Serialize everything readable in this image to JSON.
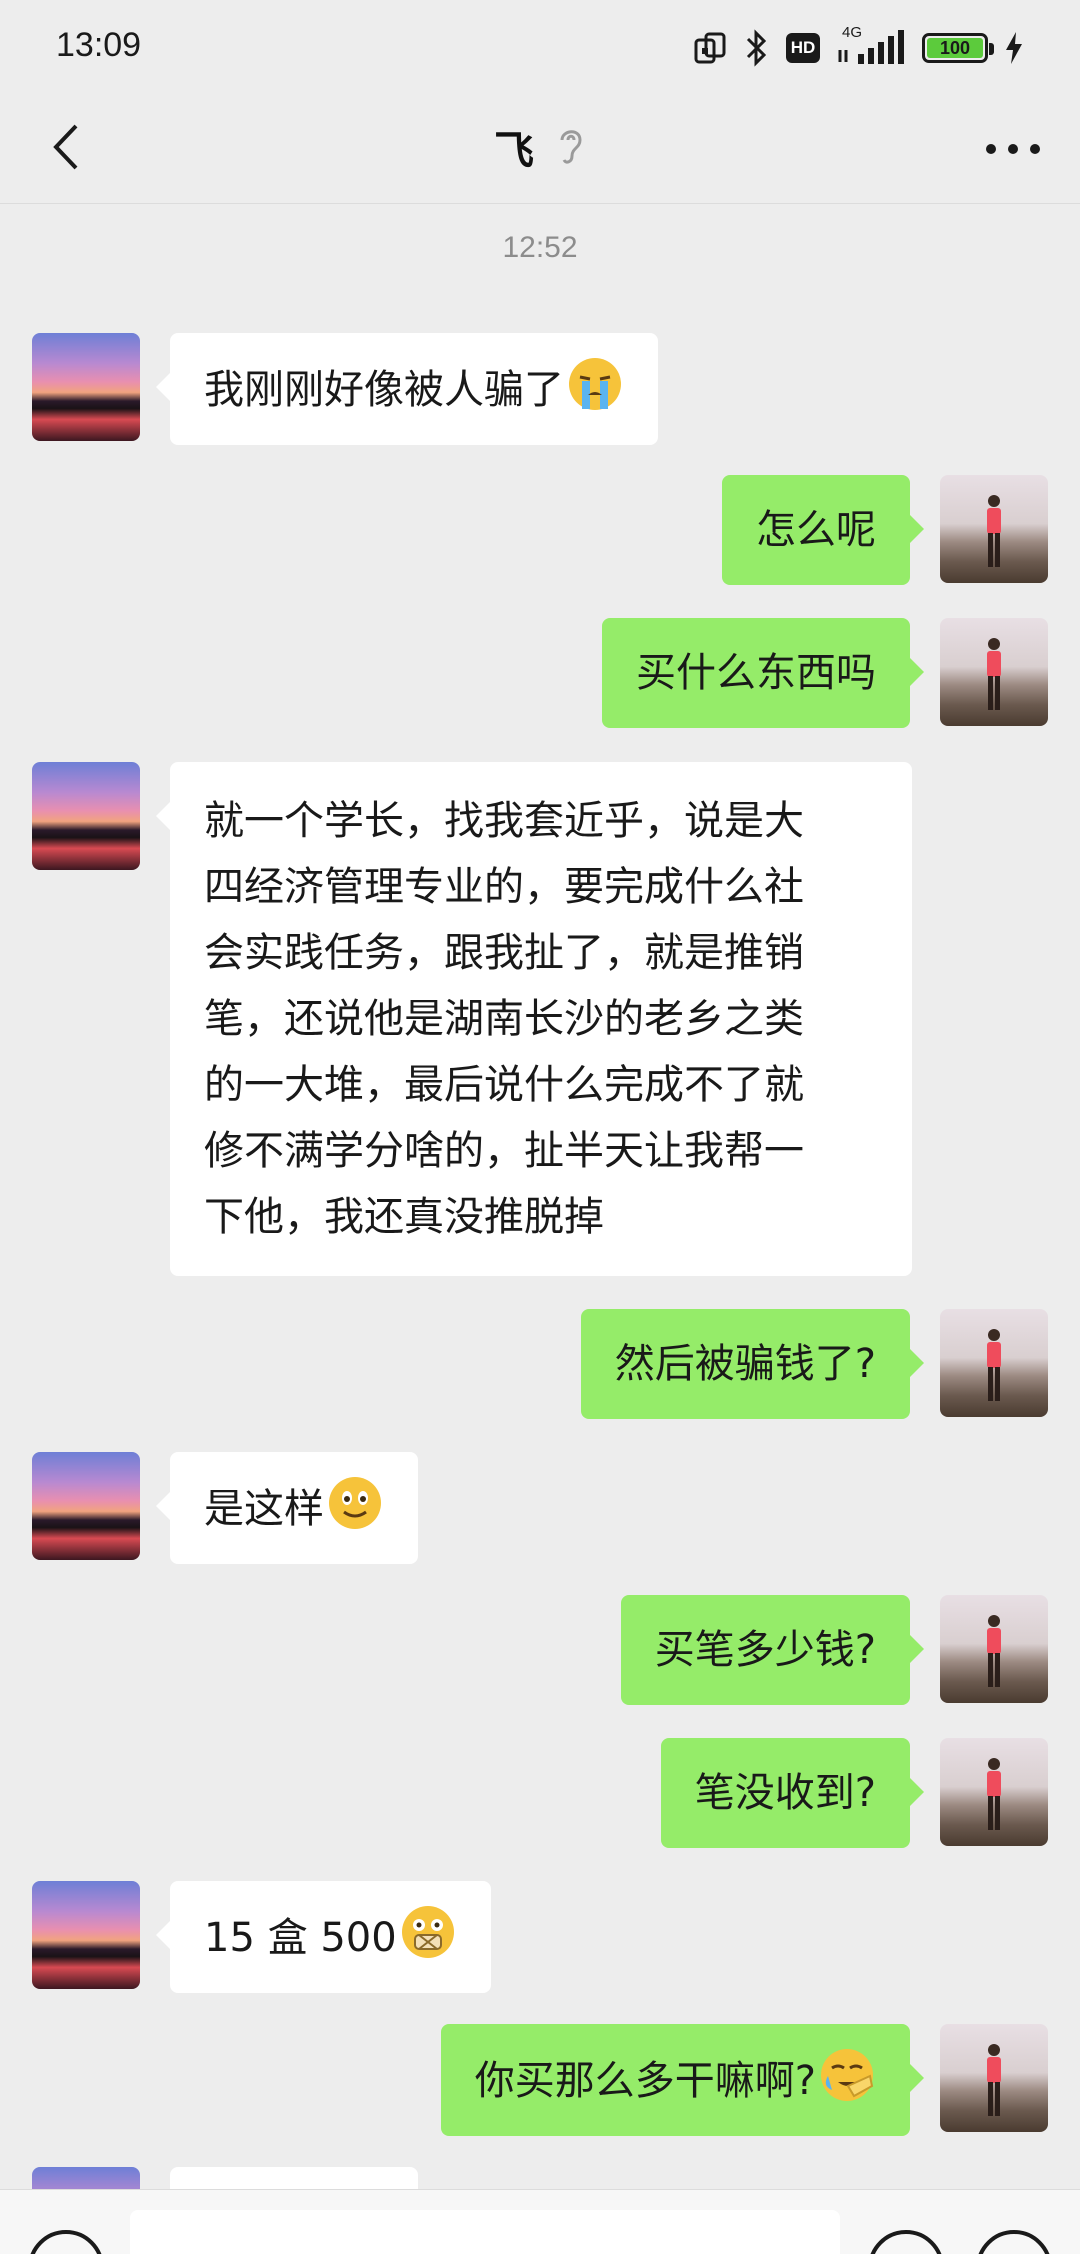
{
  "status_bar": {
    "time": "13:09",
    "network": "4G",
    "hd_label": "HD",
    "battery_level": "100"
  },
  "header": {
    "title": "飞",
    "back_icon": "chevron-left-icon",
    "earpiece_icon": "ear-icon",
    "more_icon": "more-dots-icon"
  },
  "chat": {
    "timestamp": "12:52",
    "messages": [
      {
        "side": "left",
        "text": "我刚刚好像被人骗了",
        "emoji": "crying-emoji"
      },
      {
        "side": "right",
        "text": "怎么呢"
      },
      {
        "side": "right",
        "text": "买什么东西吗"
      },
      {
        "side": "left",
        "lines": [
          "就一个学长，找我套近乎，说是大",
          "四经济管理专业的，要完成什么社",
          "会实践任务，跟我扯了，就是推销",
          "笔，还说他是湖南长沙的老乡之类",
          "的一大堆，最后说什么完成不了就",
          "修不满学分啥的，扯半天让我帮一",
          "下他，我还真没推脱掉"
        ]
      },
      {
        "side": "right",
        "text": "然后被骗钱了?"
      },
      {
        "side": "left",
        "text": "是这样",
        "emoji": "smile-emoji"
      },
      {
        "side": "right",
        "text": "买笔多少钱?"
      },
      {
        "side": "right",
        "text": "笔没收到?"
      },
      {
        "side": "left",
        "text": "15 盒 500",
        "emoji": "shocked-emoji"
      },
      {
        "side": "right",
        "text": "你买那么多干嘛啊?",
        "emoji": "facepalm-emoji"
      }
    ]
  },
  "colors": {
    "background": "#ededed",
    "self_bubble": "#95ec69",
    "friend_bubble": "#ffffff"
  }
}
